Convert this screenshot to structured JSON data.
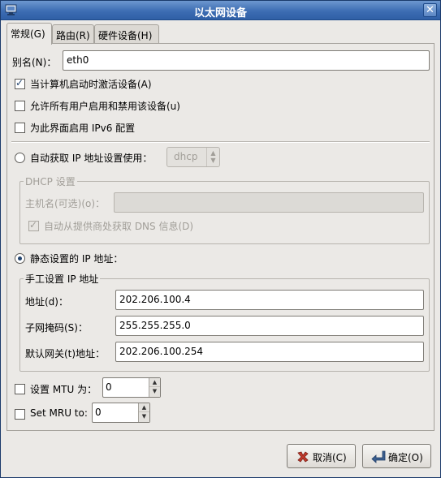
{
  "window": {
    "title": "以太网设备",
    "close_glyph": "✕"
  },
  "tabs": [
    {
      "label": "常规(G)"
    },
    {
      "label": "路由(R)"
    },
    {
      "label": "硬件设备(H)"
    }
  ],
  "general": {
    "nickname_label": "别名(N)：",
    "nickname_value": "eth0",
    "opt_activate_on_boot": {
      "label": "当计算机启动时激活设备(A)",
      "checked": true
    },
    "opt_allow_users": {
      "label": "允许所有用户启用和禁用该设备(u)",
      "checked": false
    },
    "opt_ipv6": {
      "label": "为此界面启用 IPv6 配置",
      "checked": false
    },
    "auto_ip": {
      "label": "自动获取 IP 地址设置使用：",
      "selected": false,
      "method": "dhcp"
    },
    "dhcp": {
      "title": "DHCP 设置",
      "hostname_label": "主机名(可选)(o)：",
      "hostname_value": "",
      "auto_dns": {
        "label": "自动从提供商处获取 DNS 信息(D)",
        "checked": true
      }
    },
    "static_ip": {
      "label": "静态设置的 IP 地址：",
      "selected": true,
      "frame_title": "手工设置 IP 地址",
      "address_label": "地址(d)：",
      "address_value": "202.206.100.4",
      "netmask_label": "子网掩码(S)：",
      "netmask_value": "255.255.255.0",
      "gateway_label": "默认网关(t)地址：",
      "gateway_value": "202.206.100.254"
    },
    "mtu": {
      "label": "设置 MTU 为：",
      "checked": false,
      "value": "0"
    },
    "mru": {
      "label": "Set MRU to:",
      "checked": false,
      "value": "0"
    }
  },
  "buttons": {
    "cancel": {
      "label": "取消(C)",
      "icon": "cancel-x-icon",
      "color": "#c0392b"
    },
    "ok": {
      "label": "确定(O)",
      "icon": "enter-arrow-icon",
      "color": "#3b5f8f"
    }
  },
  "colors": {
    "titlebar": "#3d6db3",
    "window_bg": "#ebe9e6",
    "radio_check": "#24456f"
  }
}
